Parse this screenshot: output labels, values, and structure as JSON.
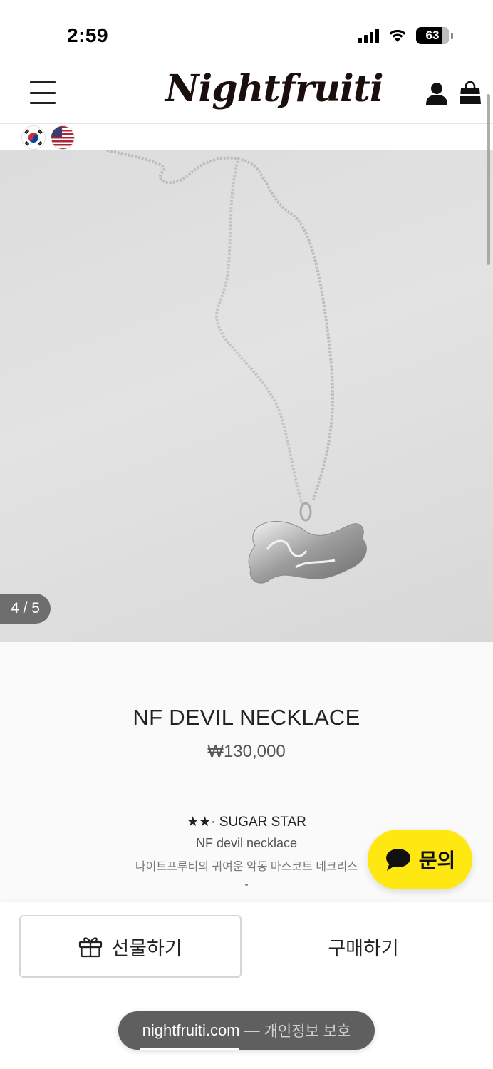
{
  "status_bar": {
    "time": "2:59",
    "battery": "63",
    "icons": [
      "cellular-signal-icon",
      "wifi-icon",
      "battery-icon"
    ]
  },
  "header": {
    "logo_text": "Nightfruiti",
    "icons": [
      "hamburger-menu-icon",
      "user-icon",
      "shopping-bag-icon"
    ]
  },
  "languages": [
    {
      "code": "ko",
      "icon": "korea-flag-icon"
    },
    {
      "code": "en",
      "icon": "usa-flag-icon"
    }
  ],
  "gallery": {
    "counter": "4 / 5",
    "current": 4,
    "total": 5
  },
  "product": {
    "name": "NF DEVIL NECKLACE",
    "price": "₩130,000",
    "description": {
      "line1": "★★· SUGAR STAR",
      "line2": "NF devil necklace",
      "line3": "나이트프루티의 귀여운 악동 마스코트 네크리스",
      "line4": "-",
      "line5": "..."
    }
  },
  "chat_button": {
    "label": "문의",
    "icon": "speech-bubble-icon",
    "color": "#ffe812"
  },
  "actions": {
    "gift_label": "선물하기",
    "gift_icon": "gift-icon",
    "buy_label": "구매하기"
  },
  "browser": {
    "domain": "nightfruiti.com",
    "separator": "—",
    "privacy_label": "개인정보 보호"
  }
}
